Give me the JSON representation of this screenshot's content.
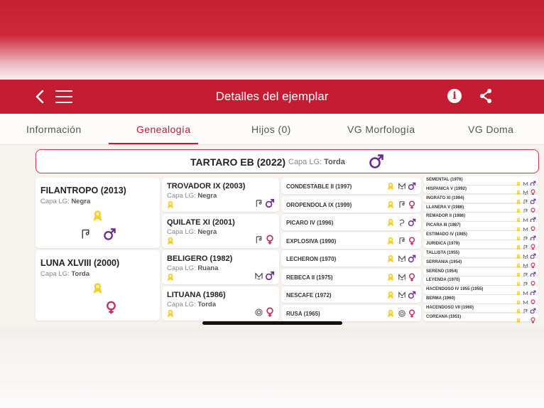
{
  "header": {
    "title": "Detalles del ejemplar",
    "back_icon": "chevron-left-icon",
    "menu_icon": "hamburger-menu-icon",
    "info_icon": "info-icon",
    "share_icon": "share-icon"
  },
  "tabs": [
    {
      "label": "Información",
      "active": false
    },
    {
      "label": "Genealogía",
      "active": true
    },
    {
      "label": "Hijos (0)",
      "active": false
    },
    {
      "label": "VG Morfología",
      "active": false
    },
    {
      "label": "VG Doma",
      "active": false
    }
  ],
  "colors": {
    "brand_red": "#c41d33",
    "male": "#6b2c8f",
    "female": "#c42a55",
    "medal": "#f2cf2c"
  },
  "capa_label": "Capa LG:",
  "root": {
    "name": "TARTARO EB (2022)",
    "capa": "Torda",
    "sex": "male"
  },
  "gen1": [
    {
      "name": "FILANTROPO (2013)",
      "capa": "Negra",
      "sex": "male",
      "icons": [
        "medal-icon",
        "music-note-icon",
        "male-icon"
      ]
    },
    {
      "name": "LUNA XLVIII (2000)",
      "capa": "Torda",
      "sex": "female",
      "icons": [
        "medal-icon",
        "female-icon"
      ]
    }
  ],
  "gen2": [
    {
      "name": "TROVADOR IX (2003)",
      "capa": "Negra",
      "sex": "male"
    },
    {
      "name": "QUILATE XI (2001)",
      "capa": "Negra",
      "sex": "female"
    },
    {
      "name": "BELIGERO (1982)",
      "capa": "Ruana",
      "sex": "male"
    },
    {
      "name": "LITUANA (1986)",
      "capa": "Torda",
      "sex": "female"
    }
  ],
  "gen3": [
    {
      "name": "CONDESTABLE II (1997)",
      "sex": "male"
    },
    {
      "name": "OROPENDOLA IX (1999)",
      "sex": "female"
    },
    {
      "name": "PICARO IV (1996)",
      "sex": "male"
    },
    {
      "name": "EXPLOSIVA (1990)",
      "sex": "female"
    },
    {
      "name": "LECHERON (1970)",
      "sex": "male"
    },
    {
      "name": "REBECA II (1975)",
      "sex": "female"
    },
    {
      "name": "NESCAFE (1972)",
      "sex": "male"
    },
    {
      "name": "RUSA (1965)",
      "sex": "female"
    }
  ],
  "gen4": [
    {
      "name": "SEMENTAL (1976)",
      "sex": "male"
    },
    {
      "name": "HISPANICA V (1992)",
      "sex": "female"
    },
    {
      "name": "INGRATO XI (1994)",
      "sex": "male"
    },
    {
      "name": "LLANERA V (1986)",
      "sex": "female"
    },
    {
      "name": "REMADOR II (1986)",
      "sex": "male"
    },
    {
      "name": "PICARA III (1987)",
      "sex": "female"
    },
    {
      "name": "ESTIMADO IV (1985)",
      "sex": "male"
    },
    {
      "name": "JURIDICA (1979)",
      "sex": "female"
    },
    {
      "name": "TALLISTA (1955)",
      "sex": "male"
    },
    {
      "name": "SERRANIA (1954)",
      "sex": "female"
    },
    {
      "name": "SERENO (1954)",
      "sex": "male"
    },
    {
      "name": "LEYENDA (1970)",
      "sex": "female"
    },
    {
      "name": "HACENDOSO IV 1955 (1955)",
      "sex": "male"
    },
    {
      "name": "BERMA (1960)",
      "sex": "female"
    },
    {
      "name": "HACENDOSO VII (1960)",
      "sex": "male"
    },
    {
      "name": "COREANA (1951)",
      "sex": "female"
    }
  ]
}
